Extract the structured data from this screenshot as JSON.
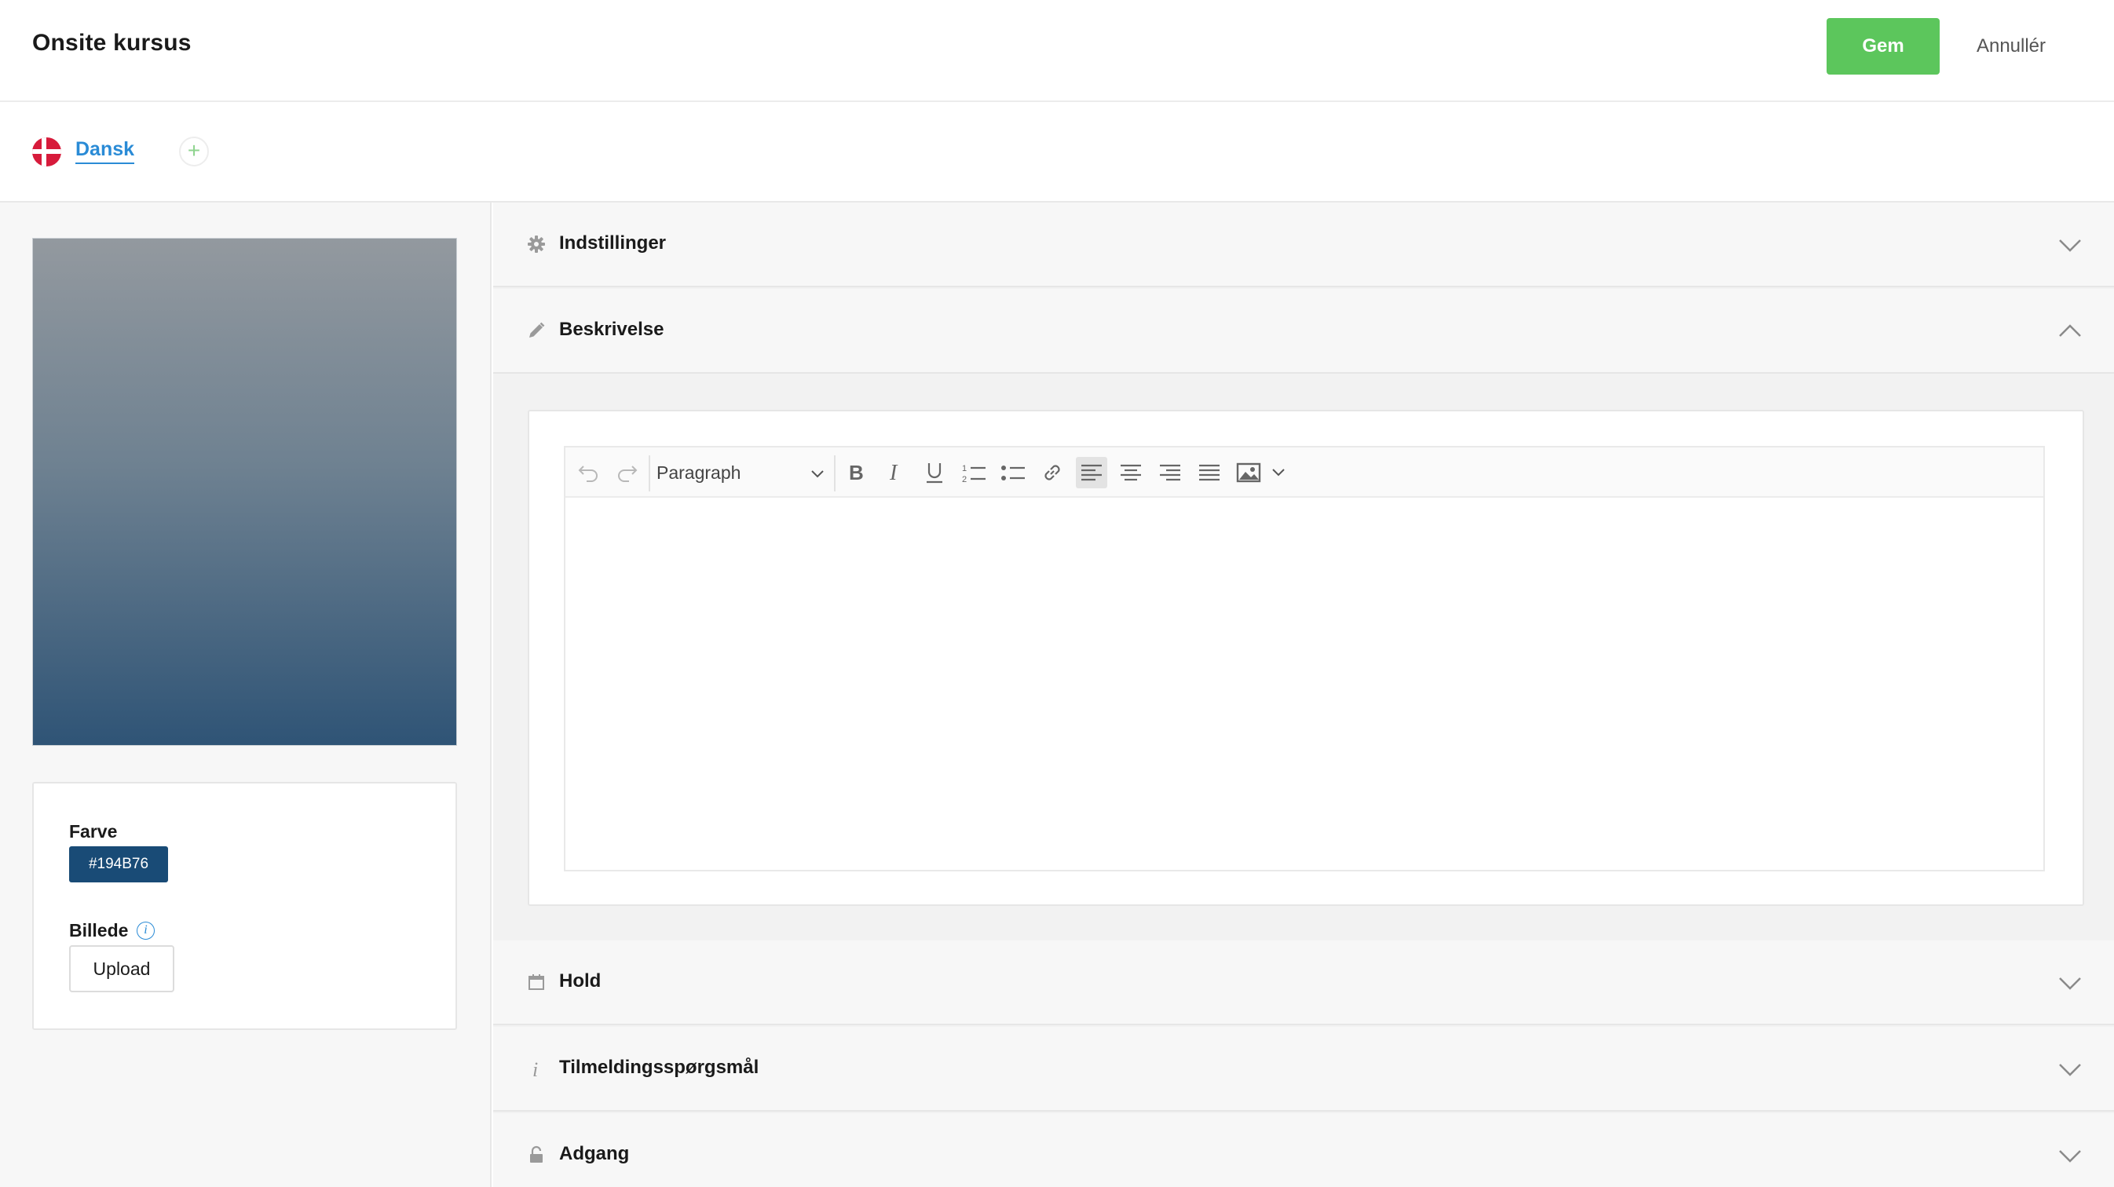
{
  "header": {
    "title": "Onsite kursus",
    "save_label": "Gem",
    "cancel_label": "Annullér"
  },
  "languages": {
    "current": "Dansk",
    "add_label": "+"
  },
  "sidebar": {
    "color_label": "Farve",
    "color_value": "#194B76",
    "image_label": "Billede",
    "info_glyph": "i",
    "upload_label": "Upload"
  },
  "sections": {
    "settings": {
      "title": "Indstillinger",
      "icon": "gear-icon",
      "expanded": false
    },
    "description": {
      "title": "Beskrivelse",
      "icon": "pencil-icon",
      "expanded": true
    },
    "teams": {
      "title": "Hold",
      "icon": "calendar-icon",
      "expanded": false
    },
    "signup_questions": {
      "title": "Tilmeldingsspørgsmål",
      "icon": "info-icon",
      "expanded": false
    },
    "access": {
      "title": "Adgang",
      "icon": "lock-icon",
      "expanded": false
    }
  },
  "editor": {
    "block_format": "Paragraph",
    "toolbar": [
      "undo",
      "redo",
      "bold",
      "italic",
      "underline",
      "ordered-list",
      "bullet-list",
      "link",
      "align-left",
      "align-center",
      "align-right",
      "align-justify",
      "image",
      "more"
    ],
    "active_alignment": "align-left",
    "content": ""
  },
  "colors": {
    "accent_green": "#5cc65c",
    "link_blue": "#2a8bd6",
    "course_color": "#194b76"
  }
}
